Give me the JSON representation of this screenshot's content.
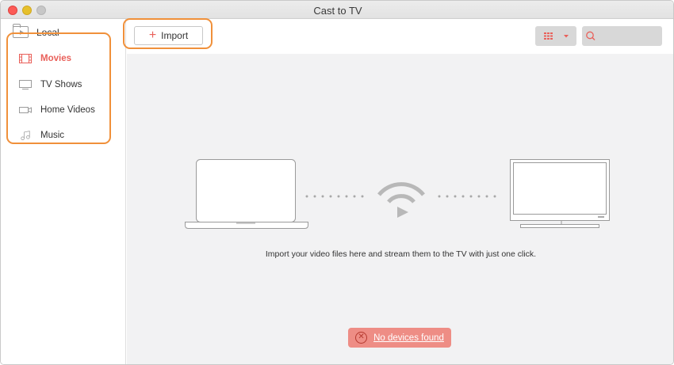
{
  "window": {
    "title": "Cast to TV"
  },
  "sidebar": {
    "local_label": "Local",
    "categories": [
      {
        "label": "Movies",
        "icon": "film-icon",
        "active": true
      },
      {
        "label": "TV Shows",
        "icon": "tv-icon",
        "active": false
      },
      {
        "label": "Home Videos",
        "icon": "video-camera-icon",
        "active": false
      },
      {
        "label": "Music",
        "icon": "music-note-icon",
        "active": false
      }
    ]
  },
  "toolbar": {
    "import_label": "Import",
    "view_icon": "grid-view-icon",
    "search_icon": "search-icon"
  },
  "main": {
    "message": "Import your video files here and stream them to the TV with just one click.",
    "status_button": "No devices found"
  },
  "colors": {
    "accent": "#e9605a",
    "highlight_outline": "#f0903a",
    "status_bg": "#ee8d85"
  }
}
